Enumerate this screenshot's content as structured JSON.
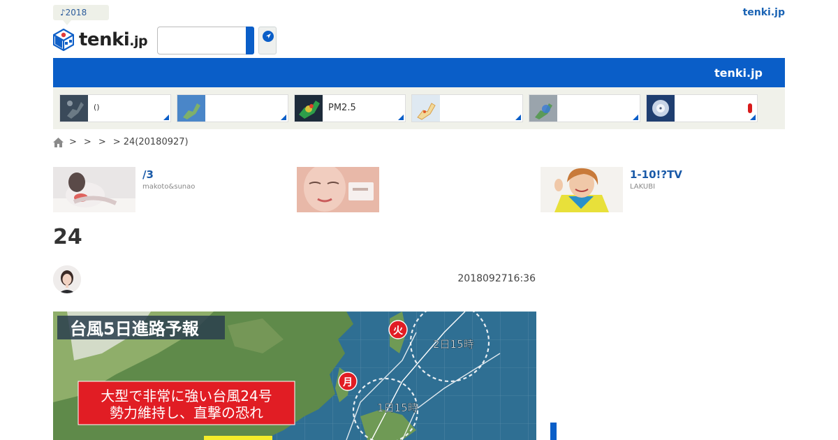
{
  "header": {
    "badge": "♪2018",
    "logo_main": "tenki",
    "logo_suffix": ".jp",
    "top_right_link": "tenki.jp",
    "search_placeholder": ""
  },
  "nav_bar": {
    "title": "tenki.jp"
  },
  "map_cards": [
    {
      "label": "()"
    },
    {
      "label": ""
    },
    {
      "label": "PM2.5"
    },
    {
      "label": ""
    },
    {
      "label": ""
    },
    {
      "label": ""
    }
  ],
  "breadcrumb": {
    "separators": [
      ">",
      ">",
      ">"
    ],
    "current": "> 24(20180927)"
  },
  "ads": [
    {
      "title": "/3",
      "source": "makoto&sunao"
    },
    {
      "title": "",
      "source": ""
    },
    {
      "title": "1-10!?TV",
      "source": "LAKUBI"
    }
  ],
  "article": {
    "title": "24",
    "datetime": "2018092716:36",
    "image_text": {
      "heading": "台風5日進路予報",
      "caption_line1": "大型で非常に強い台風24号",
      "caption_line2": "勢力維持し、直撃の恐れ",
      "marker_tue": "火",
      "marker_mon": "月",
      "time_a": "2日15時",
      "time_b": "1日15時"
    }
  },
  "colors": {
    "brand_blue": "#0a5ec8",
    "link_blue": "#1a63b4",
    "strip_bg": "#f0f1ea",
    "alert_red": "#d81b1b"
  }
}
